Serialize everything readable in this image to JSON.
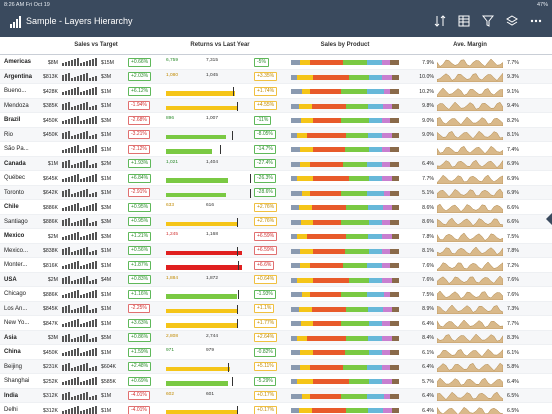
{
  "status": {
    "time_date": "8:26 AM  Fri Oct 19",
    "battery": "47%"
  },
  "app": {
    "title": "Sample - Layers Hierarchy",
    "toolbar_icons": [
      "sort-icon",
      "table-view-icon",
      "filter-icon",
      "layers-icon",
      "more-icon"
    ]
  },
  "columns": {
    "sales_vs_target": "Sales vs Target",
    "returns_vs_last_year": "Returns vs Last Year",
    "sales_by_product": "Sales by Product",
    "ave_margin": "Ave. Margin"
  },
  "colors": {
    "header_bg": "#3a4a5e",
    "positive": "#5fb85a",
    "negative": "#e07070",
    "warning": "#f0c040",
    "bar_green": "#7ac943",
    "bar_yellow": "#f5c518",
    "bar_red": "#e02020",
    "area_fill": "#d9b98a"
  },
  "rows": [
    {
      "name": "Americas",
      "level": 0,
      "sales": "$8M",
      "target": "$15M",
      "pct": "+0.66%",
      "pct_state": "pos",
      "ret_a": "6,759",
      "ret_b": "7,315",
      "ret_bar": 0.0,
      "ret_color": "green",
      "ret_tick": 0.0,
      "ret_pct": "-5%",
      "ret_state": "pos",
      "mg1": "7.9%",
      "mg2": "7.7%"
    },
    {
      "name": "Argentina",
      "level": 0,
      "sales": "$813K",
      "target": "$3M",
      "pct": "+2.03%",
      "pct_state": "pos",
      "ret_a": "1,080",
      "ret_b": "1,045",
      "ret_bar": 0.0,
      "ret_color": "yellow",
      "ret_tick": 0.0,
      "ret_pct": "+3.35%",
      "ret_state": "warn",
      "mg1": "10.0%",
      "mg2": "9.3%"
    },
    {
      "name": "Bueno...",
      "level": 1,
      "sales": "$428K",
      "target": "$1M",
      "pct": "+6.12%",
      "pct_state": "pos",
      "ret_a": "",
      "ret_b": "",
      "ret_bar": 0.82,
      "ret_color": "yellow",
      "ret_tick": 0.8,
      "ret_pct": "+1.74%",
      "ret_state": "warn",
      "mg1": "10.2%",
      "mg2": "9.1%"
    },
    {
      "name": "Mendoza",
      "level": 1,
      "sales": "$385K",
      "target": "$1M",
      "pct": "-1.94%",
      "pct_state": "neg",
      "ret_a": "",
      "ret_b": "",
      "ret_bar": 0.86,
      "ret_color": "yellow",
      "ret_tick": 0.84,
      "ret_pct": "+4.55%",
      "ret_state": "warn",
      "mg1": "9.8%",
      "mg2": "9.4%"
    },
    {
      "name": "Brazil",
      "level": 0,
      "sales": "$450K",
      "target": "$3M",
      "pct": "-2.68%",
      "pct_state": "neg",
      "ret_a": "896",
      "ret_b": "1,007",
      "ret_bar": 0.0,
      "ret_color": "green",
      "ret_tick": 0.0,
      "ret_pct": "-11%",
      "ret_state": "pos",
      "mg1": "9.0%",
      "mg2": "8.2%"
    },
    {
      "name": "Rio",
      "level": 1,
      "sales": "$450K",
      "target": "$1M",
      "pct": "-3.21%",
      "pct_state": "neg",
      "ret_a": "",
      "ret_b": "",
      "ret_bar": 0.72,
      "ret_color": "green",
      "ret_tick": 0.78,
      "ret_pct": "-8.05%",
      "ret_state": "pos",
      "mg1": "9.0%",
      "mg2": "8.1%"
    },
    {
      "name": "São Pa...",
      "level": 1,
      "sales": "",
      "target": "$1M",
      "pct": "-2.12%",
      "pct_state": "neg",
      "ret_a": "",
      "ret_b": "",
      "ret_bar": 0.55,
      "ret_color": "green",
      "ret_tick": 0.64,
      "ret_pct": "-14.7%",
      "ret_state": "pos",
      "mg1": "",
      "mg2": "7.4%"
    },
    {
      "name": "Canada",
      "level": 0,
      "sales": "$1M",
      "target": "$2M",
      "pct": "+1.93%",
      "pct_state": "pos",
      "ret_a": "1,021",
      "ret_b": "1,404",
      "ret_bar": 0.0,
      "ret_color": "green",
      "ret_tick": 0.0,
      "ret_pct": "-27.4%",
      "ret_state": "pos",
      "mg1": "6.4%",
      "mg2": "6.9%"
    },
    {
      "name": "Québec",
      "level": 1,
      "sales": "$645K",
      "target": "$1M",
      "pct": "+6.84%",
      "pct_state": "pos",
      "ret_a": "",
      "ret_b": "",
      "ret_bar": 0.74,
      "ret_color": "green",
      "ret_tick": 1.0,
      "ret_pct": "-26.3%",
      "ret_state": "pos",
      "mg1": "7.7%",
      "mg2": "6.9%"
    },
    {
      "name": "Toronto",
      "level": 1,
      "sales": "$642K",
      "target": "$1M",
      "pct": "-2.91%",
      "pct_state": "neg",
      "ret_a": "",
      "ret_b": "",
      "ret_bar": 0.72,
      "ret_color": "green",
      "ret_tick": 1.0,
      "ret_pct": "-28.6%",
      "ret_state": "pos",
      "mg1": "5.1%",
      "mg2": "6.9%"
    },
    {
      "name": "Chile",
      "level": 0,
      "sales": "$886K",
      "target": "$3M",
      "pct": "+0.95%",
      "pct_state": "pos",
      "ret_a": "633",
      "ret_b": "616",
      "ret_bar": 0.0,
      "ret_color": "yellow",
      "ret_tick": 0.0,
      "ret_pct": "+2.76%",
      "ret_state": "warn",
      "mg1": "8.6%",
      "mg2": "6.6%"
    },
    {
      "name": "Santiago",
      "level": 1,
      "sales": "$886K",
      "target": "$3M",
      "pct": "+0.95%",
      "pct_state": "pos",
      "ret_a": "",
      "ret_b": "",
      "ret_bar": 0.86,
      "ret_color": "yellow",
      "ret_tick": 0.84,
      "ret_pct": "+2.76%",
      "ret_state": "warn",
      "mg1": "8.6%",
      "mg2": "6.6%"
    },
    {
      "name": "Mexico",
      "level": 0,
      "sales": "$2M",
      "target": "$3M",
      "pct": "+1.21%",
      "pct_state": "pos",
      "ret_a": "1,245",
      "ret_b": "1,168",
      "ret_bar": 0.0,
      "ret_color": "red",
      "ret_tick": 0.0,
      "ret_pct": "+6.59%",
      "ret_state": "neg",
      "mg1": "7.8%",
      "mg2": "7.5%"
    },
    {
      "name": "Mexico...",
      "level": 1,
      "sales": "$838K",
      "target": "$1M",
      "pct": "+0.56%",
      "pct_state": "pos",
      "ret_a": "",
      "ret_b": "",
      "ret_bar": 0.9,
      "ret_color": "red",
      "ret_tick": 0.84,
      "ret_pct": "+6.59%",
      "ret_state": "neg",
      "mg1": "8.1%",
      "mg2": "7.8%"
    },
    {
      "name": "Monter...",
      "level": 1,
      "sales": "$816K",
      "target": "$1M",
      "pct": "+1.87%",
      "pct_state": "pos",
      "ret_a": "",
      "ret_b": "",
      "ret_bar": 0.9,
      "ret_color": "red",
      "ret_tick": 0.86,
      "ret_pct": "+6.6%",
      "ret_state": "neg",
      "mg1": "7.6%",
      "mg2": "7.2%"
    },
    {
      "name": "USA",
      "level": 0,
      "sales": "$2M",
      "target": "$4M",
      "pct": "+0.83%",
      "pct_state": "pos",
      "ret_a": "1,884",
      "ret_b": "1,872",
      "ret_bar": 0.0,
      "ret_color": "yellow",
      "ret_tick": 0.0,
      "ret_pct": "+0.64%",
      "ret_state": "warn",
      "mg1": "7.6%",
      "mg2": "7.6%"
    },
    {
      "name": "Chicago",
      "level": 1,
      "sales": "$886K",
      "target": "$1M",
      "pct": "+1.16%",
      "pct_state": "pos",
      "ret_a": "",
      "ret_b": "",
      "ret_bar": 0.84,
      "ret_color": "green",
      "ret_tick": 0.86,
      "ret_pct": "-1.93%",
      "ret_state": "pos",
      "mg1": "7.5%",
      "mg2": "7.6%"
    },
    {
      "name": "Los An...",
      "level": 1,
      "sales": "$845K",
      "target": "$1M",
      "pct": "-2.25%",
      "pct_state": "neg",
      "ret_a": "",
      "ret_b": "",
      "ret_bar": 0.86,
      "ret_color": "yellow",
      "ret_tick": 0.84,
      "ret_pct": "+1.1%",
      "ret_state": "warn",
      "mg1": "8.9%",
      "mg2": "7.3%"
    },
    {
      "name": "New Yo...",
      "level": 1,
      "sales": "$847K",
      "target": "$1M",
      "pct": "+3.63%",
      "pct_state": "pos",
      "ret_a": "",
      "ret_b": "",
      "ret_bar": 0.86,
      "ret_color": "yellow",
      "ret_tick": 0.84,
      "ret_pct": "+1.77%",
      "ret_state": "warn",
      "mg1": "6.4%",
      "mg2": "7.7%"
    },
    {
      "name": "Asia",
      "level": 0,
      "sales": "$3M",
      "target": "$5M",
      "pct": "+0.86%",
      "pct_state": "pos",
      "ret_a": "2,808",
      "ret_b": "2,744",
      "ret_bar": 0.0,
      "ret_color": "yellow",
      "ret_tick": 0.0,
      "ret_pct": "+2.64%",
      "ret_state": "warn",
      "mg1": "8.4%",
      "mg2": "8.3%"
    },
    {
      "name": "China",
      "level": 0,
      "sales": "$450K",
      "target": "$1M",
      "pct": "+1.59%",
      "pct_state": "pos",
      "ret_a": "971",
      "ret_b": "979",
      "ret_bar": 0.0,
      "ret_color": "green",
      "ret_tick": 0.0,
      "ret_pct": "-0.82%",
      "ret_state": "pos",
      "mg1": "6.1%",
      "mg2": "6.1%"
    },
    {
      "name": "Beijing",
      "level": 1,
      "sales": "$231K",
      "target": "$604K",
      "pct": "+2.48%",
      "pct_state": "pos",
      "ret_a": "",
      "ret_b": "",
      "ret_bar": 0.76,
      "ret_color": "yellow",
      "ret_tick": 0.74,
      "ret_pct": "+5.11%",
      "ret_state": "warn",
      "mg1": "6.4%",
      "mg2": "5.8%"
    },
    {
      "name": "Shanghai",
      "level": 1,
      "sales": "$252K",
      "target": "$585K",
      "pct": "+0.69%",
      "pct_state": "pos",
      "ret_a": "",
      "ret_b": "",
      "ret_bar": 0.74,
      "ret_color": "green",
      "ret_tick": 0.78,
      "ret_pct": "-5.29%",
      "ret_state": "pos",
      "mg1": "5.7%",
      "mg2": "6.4%"
    },
    {
      "name": "India",
      "level": 0,
      "sales": "$312K",
      "target": "$1M",
      "pct": "-4.01%",
      "pct_state": "neg",
      "ret_a": "602",
      "ret_b": "601",
      "ret_bar": 0.0,
      "ret_color": "yellow",
      "ret_tick": 0.0,
      "ret_pct": "+0.17%",
      "ret_state": "warn",
      "mg1": "6.4%",
      "mg2": "6.5%"
    },
    {
      "name": "Delhi",
      "level": 1,
      "sales": "$312K",
      "target": "$1M",
      "pct": "-4.01%",
      "pct_state": "neg",
      "ret_a": "",
      "ret_b": "",
      "ret_bar": 0.86,
      "ret_color": "yellow",
      "ret_tick": 0.84,
      "ret_pct": "+0.17%",
      "ret_state": "warn",
      "mg1": "6.4%",
      "mg2": "6.5%"
    }
  ]
}
